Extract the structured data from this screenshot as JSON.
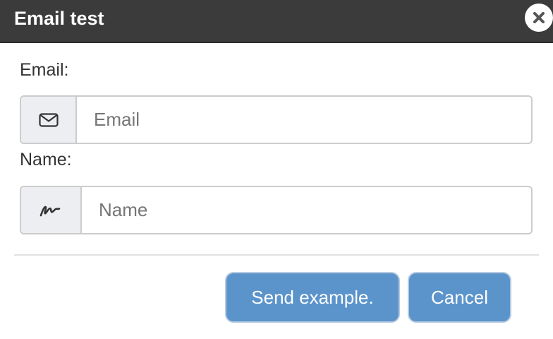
{
  "dialog": {
    "title": "Email test",
    "close_icon": "close-icon"
  },
  "form": {
    "email": {
      "label": "Email:",
      "placeholder": "Email",
      "value": "",
      "icon": "envelope-icon"
    },
    "name": {
      "label": "Name:",
      "placeholder": "Name",
      "value": "",
      "icon": "signature-icon"
    }
  },
  "footer": {
    "send_label": "Send example.",
    "cancel_label": "Cancel"
  },
  "colors": {
    "titlebar": "#3b3b3b",
    "button": "#5b93cb",
    "addon": "#eceef1"
  }
}
